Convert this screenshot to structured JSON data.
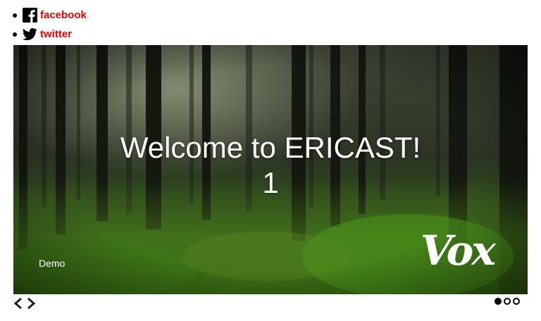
{
  "social": [
    {
      "label": "facebook",
      "icon": "facebook-icon"
    },
    {
      "label": "twitter",
      "icon": "twitter-icon"
    }
  ],
  "slider": {
    "title": "Welcome to ERICAST!",
    "number": "1",
    "caption": "Demo",
    "logo": "Vox",
    "background": "forest-photo",
    "total_slides": 3,
    "active_slide": 1
  },
  "colors": {
    "link": "#e00000",
    "text_on_image": "#ffffff"
  }
}
